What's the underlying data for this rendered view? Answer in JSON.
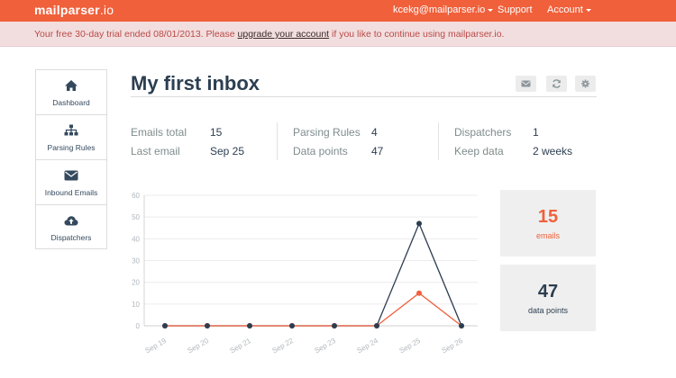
{
  "brand": {
    "name": "mailparser",
    "tld": ".io"
  },
  "nav": {
    "user": "kcekg@mailparser.io",
    "support": "Support",
    "account": "Account"
  },
  "alert": {
    "before": "Your free 30-day trial ended 08/01/2013. Please ",
    "link": "upgrade your account",
    "after": " if you like to continue using mailparser.io."
  },
  "sidebar": {
    "items": [
      {
        "label": "Dashboard",
        "icon": "home-icon"
      },
      {
        "label": "Parsing Rules",
        "icon": "sitemap-icon"
      },
      {
        "label": "Inbound Emails",
        "icon": "envelope-icon"
      },
      {
        "label": "Dispatchers",
        "icon": "cloud-upload-icon"
      }
    ]
  },
  "page": {
    "title": "My first inbox"
  },
  "toolbar": {
    "icons": [
      "envelope-icon",
      "refresh-icon",
      "gear-icon"
    ]
  },
  "stats": {
    "emails_total": {
      "label": "Emails total",
      "value": "15"
    },
    "last_email": {
      "label": "Last email",
      "value": "Sep 25"
    },
    "parsing_rules": {
      "label": "Parsing Rules",
      "value": "4"
    },
    "data_points": {
      "label": "Data points",
      "value": "47"
    },
    "dispatchers": {
      "label": "Dispatchers",
      "value": "1"
    },
    "keep_data": {
      "label": "Keep data",
      "value": "2 weeks"
    }
  },
  "cards": {
    "emails": {
      "value": "15",
      "label": "emails",
      "color": "#f0603b"
    },
    "data_points": {
      "value": "47",
      "label": "data points",
      "color": "#2c3e50"
    }
  },
  "colors": {
    "accent": "#f0603b",
    "dark": "#2c3e50",
    "alert_text": "#b94a48"
  },
  "chart_data": {
    "type": "line",
    "categories": [
      "Sep 19",
      "Sep 20",
      "Sep 21",
      "Sep 22",
      "Sep 23",
      "Sep 24",
      "Sep 25",
      "Sep 26"
    ],
    "yticks": [
      "0",
      "10",
      "20",
      "30",
      "40",
      "50",
      "60"
    ],
    "ylim": [
      0,
      60
    ],
    "grid": true,
    "series": [
      {
        "values": [
          0,
          0,
          0,
          0,
          0,
          0,
          47,
          0
        ],
        "color": "#2c3e50"
      },
      {
        "values": [
          0,
          0,
          0,
          0,
          0,
          0,
          15,
          0
        ],
        "color": "#f0603b"
      }
    ]
  }
}
